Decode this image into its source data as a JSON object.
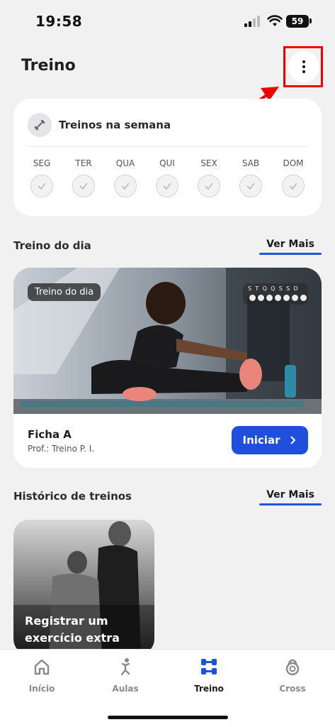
{
  "status_bar": {
    "time": "19:58",
    "battery": "59"
  },
  "header": {
    "title": "Treino",
    "menu_icon": "more-vertical-icon"
  },
  "week": {
    "title": "Treinos na semana",
    "icon": "dumbbell-icon",
    "days": [
      "SEG",
      "TER",
      "QUA",
      "QUI",
      "SEX",
      "SAB",
      "DOM"
    ]
  },
  "workout_of_day": {
    "section_title": "Treino do dia",
    "see_more": "Ver Mais",
    "tag": "Treino do dia",
    "week_letters": "STQQSSD",
    "sheet_name": "Ficha A",
    "professor": "Prof.: Treino P. I.",
    "start_label": "Iniciar"
  },
  "history": {
    "section_title": "Histórico de treinos",
    "see_more": "Ver Mais",
    "card_text": "Registrar um exercício extra"
  },
  "tabs": [
    {
      "label": "Início",
      "icon": "home-icon",
      "active": false
    },
    {
      "label": "Aulas",
      "icon": "yoga-person-icon",
      "active": false
    },
    {
      "label": "Treino",
      "icon": "dumbbell-grid-icon",
      "active": true
    },
    {
      "label": "Cross",
      "icon": "kettlebell-icon",
      "active": false
    }
  ],
  "colors": {
    "accent": "#1f4fdc",
    "annotation": "#e00000",
    "background": "#f1f1f2"
  }
}
